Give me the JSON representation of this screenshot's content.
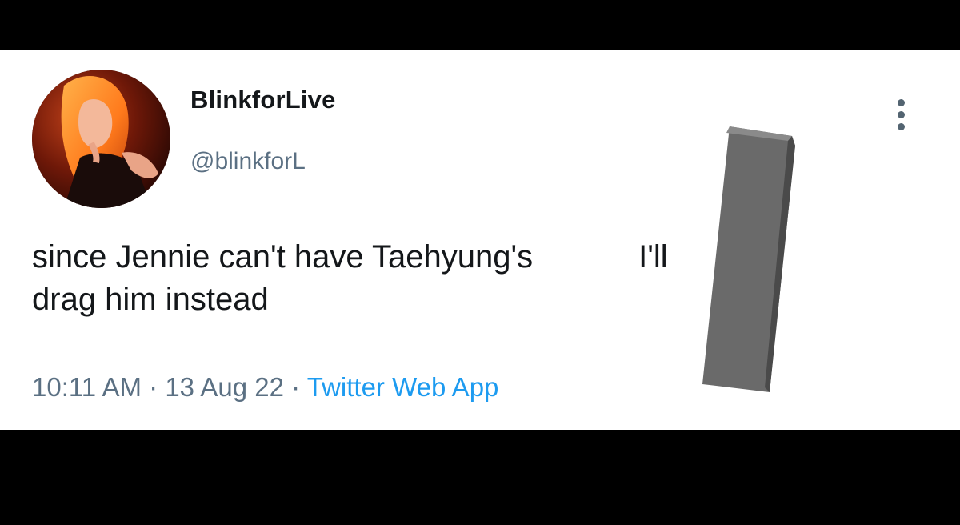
{
  "tweet": {
    "display_name": "BlinkforLive",
    "handle": "@blinkforL",
    "text_line_1": "since Jennie can't have Taehyung's",
    "text_line_1_tail": "I'll",
    "text_line_2": "drag him instead",
    "time": "10:11 AM",
    "separator_1": "·",
    "date": "13 Aug 22",
    "separator_2": "·",
    "source": "Twitter Web App"
  },
  "icons": {
    "more": "more-vertical-icon"
  },
  "colors": {
    "text_primary": "#14171a",
    "text_secondary": "#5b7083",
    "link": "#1d9bf0",
    "background": "#ffffff",
    "letterbox": "#000000",
    "redaction": "#666666"
  }
}
